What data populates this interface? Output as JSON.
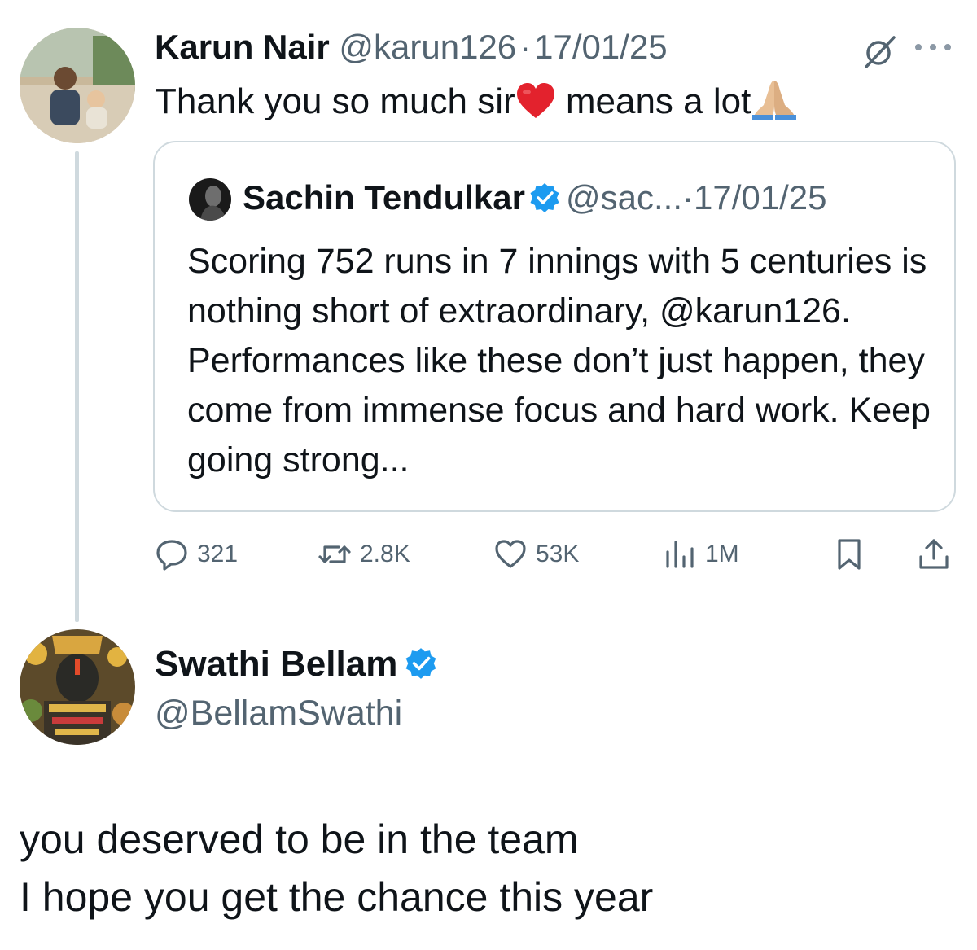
{
  "tweet": {
    "author_name": "Karun Nair",
    "author_handle": "@karun126",
    "separator": "·",
    "date": "17/01/25",
    "text_part1": "Thank you so much sir",
    "text_part2": " means a lot",
    "emoji1": "red-heart",
    "emoji2": "folded-hands",
    "more_label": "···"
  },
  "quote": {
    "author_name": "Sachin Tendulkar",
    "author_handle": "@sac...",
    "separator": "·",
    "date": "17/01/25",
    "verified": true,
    "text": "Scoring 752 runs in 7 innings with 5 centuries is nothing short of extraordinary, @karun126. Performances like these don’t just happen, they come from immense focus and hard work. Keep going strong..."
  },
  "actions": {
    "replies": "321",
    "reposts": "2.8K",
    "likes": "53K",
    "views": "1M"
  },
  "reply": {
    "author_name": "Swathi Bellam",
    "author_handle": "@BellamSwathi",
    "verified": true,
    "line1": "you deserved to be in the team",
    "line2": "I hope you get the chance this year"
  },
  "colors": {
    "text": "#0f1419",
    "muted": "#536471",
    "border": "#cfd9de",
    "verified_blue": "#1d9bf0"
  }
}
